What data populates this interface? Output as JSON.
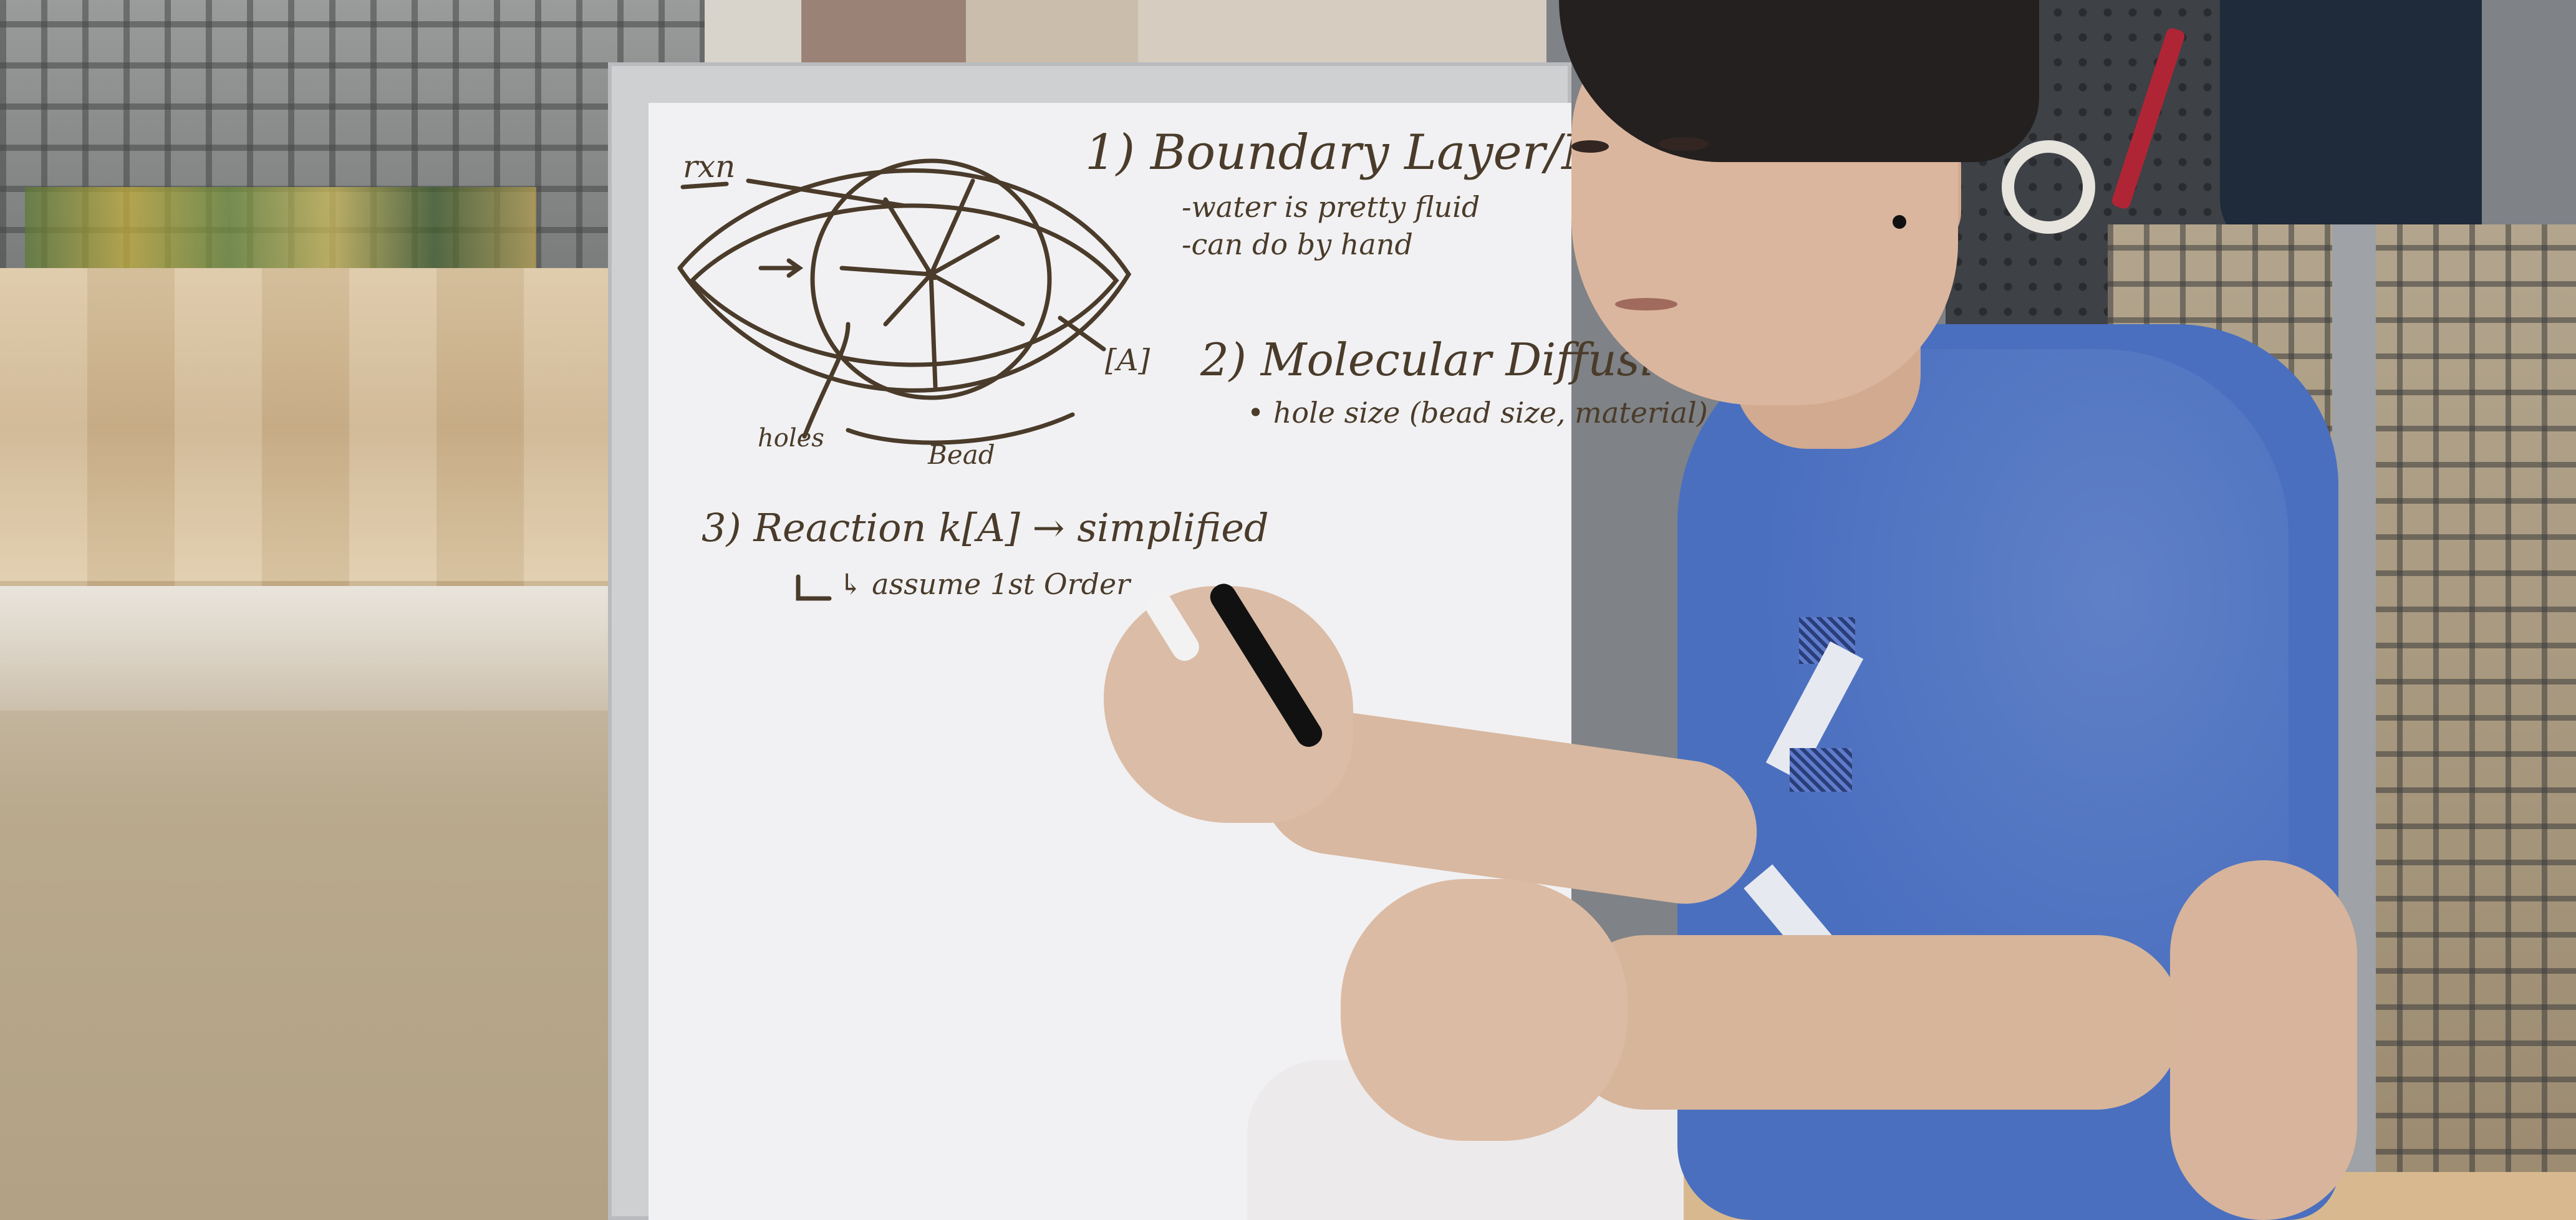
{
  "scene": {
    "description_visible_text_only": true
  },
  "whiteboard": {
    "label_rxn": "rxn",
    "label_holes": "holes",
    "label_bead": "Bead",
    "label_A": "[A]",
    "item1_title": "1) Boundary Layer/Mass",
    "item1_line1": "-water is pretty fluid",
    "item1_line2": "-can do by hand",
    "item2_title": "2) Molecular Diffusion",
    "item2_line1": "• hole size (bead size, material)",
    "item3_title": "3) Reaction  k[A] → simplified",
    "item3_line1": "↳ assume 1st Order"
  },
  "colors": {
    "marker_ink": "#4a3b2a",
    "shirt": "#4a6fbf",
    "board": "#f1f1f3"
  }
}
